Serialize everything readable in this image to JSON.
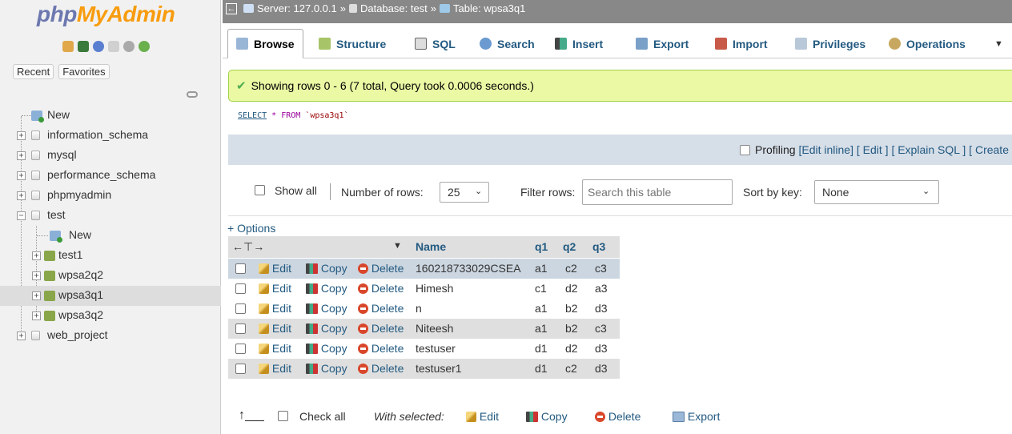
{
  "logo": {
    "part1": "php",
    "part2": "MyAdmin"
  },
  "nav_tabs": [
    "Recent",
    "Favorites"
  ],
  "tree": [
    {
      "label": "New",
      "kind": "new"
    },
    {
      "label": "information_schema",
      "kind": "db"
    },
    {
      "label": "mysql",
      "kind": "db"
    },
    {
      "label": "performance_schema",
      "kind": "db"
    },
    {
      "label": "phpmyadmin",
      "kind": "db"
    },
    {
      "label": "test",
      "kind": "db-open"
    },
    {
      "label": "New",
      "kind": "child-new"
    },
    {
      "label": "test1",
      "kind": "table"
    },
    {
      "label": "wpsa2q2",
      "kind": "table"
    },
    {
      "label": "wpsa3q1",
      "kind": "table-selected"
    },
    {
      "label": "wpsa3q2",
      "kind": "table"
    },
    {
      "label": "web_project",
      "kind": "db"
    }
  ],
  "breadcrumb": {
    "server": "Server: 127.0.0.1",
    "sep1": "»",
    "database": "Database: test",
    "sep2": "»",
    "table": "Table: wpsa3q1"
  },
  "tabs": [
    {
      "label": "Browse",
      "active": true,
      "icon": "browse-icon"
    },
    {
      "label": "Structure",
      "icon": "structure-icon"
    },
    {
      "label": "SQL",
      "icon": "sql-icon"
    },
    {
      "label": "Search",
      "icon": "search-icon"
    },
    {
      "label": "Insert",
      "icon": "insert-icon"
    },
    {
      "label": "Export",
      "icon": "export-icon"
    },
    {
      "label": "Import",
      "icon": "import-icon"
    },
    {
      "label": "Privileges",
      "icon": "privileges-icon"
    },
    {
      "label": "Operations",
      "icon": "operations-icon"
    }
  ],
  "success_message": "Showing rows 0 - 6 (7 total, Query took 0.0006 seconds.)",
  "sql": {
    "select": "SELECT",
    "star": " * ",
    "from": "FROM",
    "table": " `wpsa3q1`"
  },
  "profiling": {
    "label": "Profiling",
    "edit_inline": "[Edit inline]",
    "edit": "[ Edit ]",
    "explain": "[ Explain SQL ]",
    "create": "[ Create"
  },
  "navbar": {
    "show_all": "Show all",
    "rows_label": "Number of rows:",
    "rows_value": "25",
    "filter_label": "Filter rows:",
    "filter_placeholder": "Search this table",
    "sortkey_label": "Sort by key:",
    "sortkey_value": "None"
  },
  "options_link": "+ Options",
  "table": {
    "columns": [
      "Name",
      "q1",
      "q2",
      "q3"
    ],
    "action_labels": {
      "edit": "Edit",
      "copy": "Copy",
      "delete": "Delete"
    },
    "rows": [
      [
        "160218733029CSEA",
        "a1",
        "c2",
        "c3"
      ],
      [
        "Himesh",
        "c1",
        "d2",
        "a3"
      ],
      [
        "n",
        "a1",
        "b2",
        "d3"
      ],
      [
        "Niteesh",
        "a1",
        "b2",
        "c3"
      ],
      [
        "testuser",
        "d1",
        "d2",
        "d3"
      ],
      [
        "testuser1",
        "d1",
        "c2",
        "d3"
      ]
    ]
  },
  "footer": {
    "check_all": "Check all",
    "with_selected": "With selected:",
    "edit": "Edit",
    "copy": "Copy",
    "delete": "Delete",
    "export": "Export"
  },
  "colors": {
    "link": "#235a81",
    "success_bg": "#ebf8a4",
    "topbar": "#888888"
  }
}
